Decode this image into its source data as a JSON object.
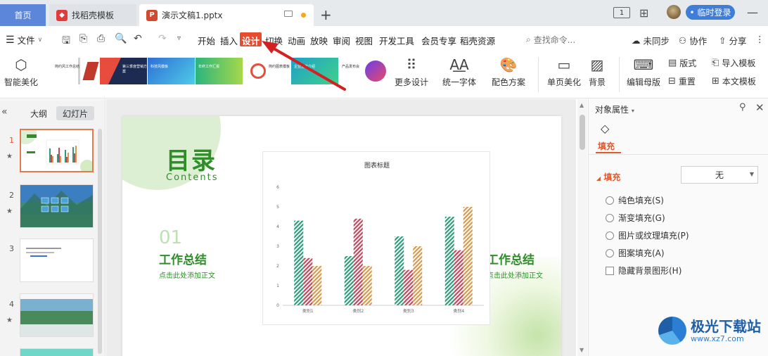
{
  "tabs": {
    "home": "首页",
    "daoke": "找稻壳模板",
    "document": "演示文稿1.pptx",
    "login": "• 临时登录",
    "layout_badge": "1"
  },
  "menu": {
    "file": "文件",
    "items": [
      "开始",
      "插入",
      "设计",
      "切换",
      "动画",
      "放映",
      "审阅",
      "视图",
      "开发工具",
      "会员专享",
      "稻壳资源"
    ],
    "active": "设计",
    "search_placeholder": "查找命令...",
    "unsynced": "未同步",
    "collaborate": "协作",
    "share": "分享"
  },
  "ribbon": {
    "smart_beautify": "智能美化",
    "more_design": "更多设计",
    "unify_font": "统一字体",
    "color_scheme": "配色方案",
    "single_page_beautify": "单页美化",
    "background": "背景",
    "edit_master": "编辑母版",
    "layout": "版式",
    "reset": "重置",
    "import_template": "导入模板",
    "this_template": "本文模板",
    "template_thumbs": [
      "简约风工作总结",
      "第三季度营销方案",
      "科技风模板",
      "年终工作汇报",
      "简约图表模板",
      "企业宣传介绍",
      "产品发布会"
    ]
  },
  "left_panel": {
    "outline_tab": "大纲",
    "slides_tab": "幻灯片",
    "slide_numbers": [
      "1",
      "2",
      "3",
      "4"
    ]
  },
  "slide": {
    "title_cn": "目录",
    "title_en": "Contents",
    "number": "01",
    "section1": "工作总结",
    "section1_sub": "点击此处添加正文",
    "section2": "工作总结",
    "section2_sub": "点击此处添加正文"
  },
  "chart_data": {
    "type": "bar",
    "title": "图表标题",
    "categories": [
      "类别1",
      "类别2",
      "类别3",
      "类别4"
    ],
    "series": [
      {
        "values": [
          4.3,
          2.5,
          3.5,
          4.5
        ],
        "color": "#2e9c7a"
      },
      {
        "values": [
          2.4,
          4.4,
          1.8,
          2.8
        ],
        "color": "#c2475e"
      },
      {
        "values": [
          2.0,
          2.0,
          3.0,
          5.0
        ],
        "color": "#d59a4e"
      }
    ],
    "ylim": [
      0,
      6
    ],
    "yticks": [
      "0",
      "1",
      "2",
      "3",
      "4",
      "5",
      "6"
    ],
    "pattern": "diagonal-hatch",
    "grid": false,
    "legend": "none"
  },
  "right_panel": {
    "title": "对象属性",
    "fill_tab": "填充",
    "fill_heading": "填充",
    "fill_value": "无",
    "options": [
      "纯色填充(S)",
      "渐变填充(G)",
      "图片或纹理填充(P)",
      "图案填充(A)"
    ],
    "hide_bg": "隐藏背景图形(H)"
  },
  "watermark": {
    "brand": "极光下载站",
    "url": "www.xz7.com"
  },
  "colors": {
    "accent_blue": "#5b86d9",
    "design_tab": "#e74c2e",
    "slide_green": "#2f8e2a",
    "fill_orange": "#e2582e",
    "arrow_red": "#d42020"
  }
}
